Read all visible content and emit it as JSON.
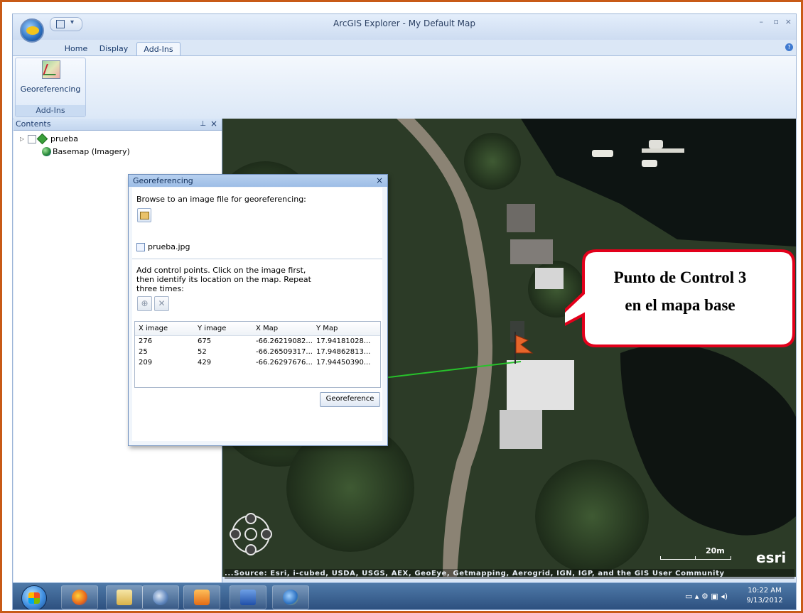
{
  "window": {
    "title": "ArcGIS Explorer - My Default Map",
    "min_glyph": "–",
    "restore_glyph": "▫",
    "close_glyph": "×"
  },
  "tabs": [
    {
      "label": "Home"
    },
    {
      "label": "Display"
    },
    {
      "label": "Add-Ins",
      "active": true
    }
  ],
  "ribbon": {
    "button_label": "Georeferencing",
    "group_label": "Add-Ins"
  },
  "contents": {
    "title": "Contents",
    "layers": [
      {
        "label": "prueba"
      },
      {
        "label": "Basemap (Imagery)"
      }
    ]
  },
  "geo_dialog": {
    "title": "Georeferencing",
    "browse_text": "Browse to an image file for georeferencing:",
    "image_name": "prueba.jpg",
    "instructions_lines": [
      "Add control points. Click on the image first,",
      "then identify its location on the map. Repeat",
      "three times:"
    ],
    "columns": [
      "X image",
      "Y image",
      "X Map",
      "Y Map"
    ],
    "rows": [
      [
        "276",
        "675",
        "-66.26219082...",
        "17.94181028..."
      ],
      [
        "25",
        "52",
        "-66.26509317...",
        "17.94862813..."
      ],
      [
        "209",
        "429",
        "-66.26297676...",
        "17.94450390..."
      ]
    ],
    "georeference_label": "Georeference"
  },
  "callout": {
    "line1": "Punto de Control 3",
    "line2": "en el mapa base",
    "border_color": "#e3001b"
  },
  "map": {
    "attribution": "...Source: Esri, i-cubed, USDA, USGS, AEX, GeoEye, Getmapping, Aerogrid, IGN, IGP, and the GIS User Community",
    "scale_label": "20m",
    "logo": "esri"
  },
  "taskbar": {
    "time": "10:22 AM",
    "date": "9/13/2012"
  },
  "colors": {
    "frame": "#c85a16",
    "link_line": "#27c22b"
  }
}
